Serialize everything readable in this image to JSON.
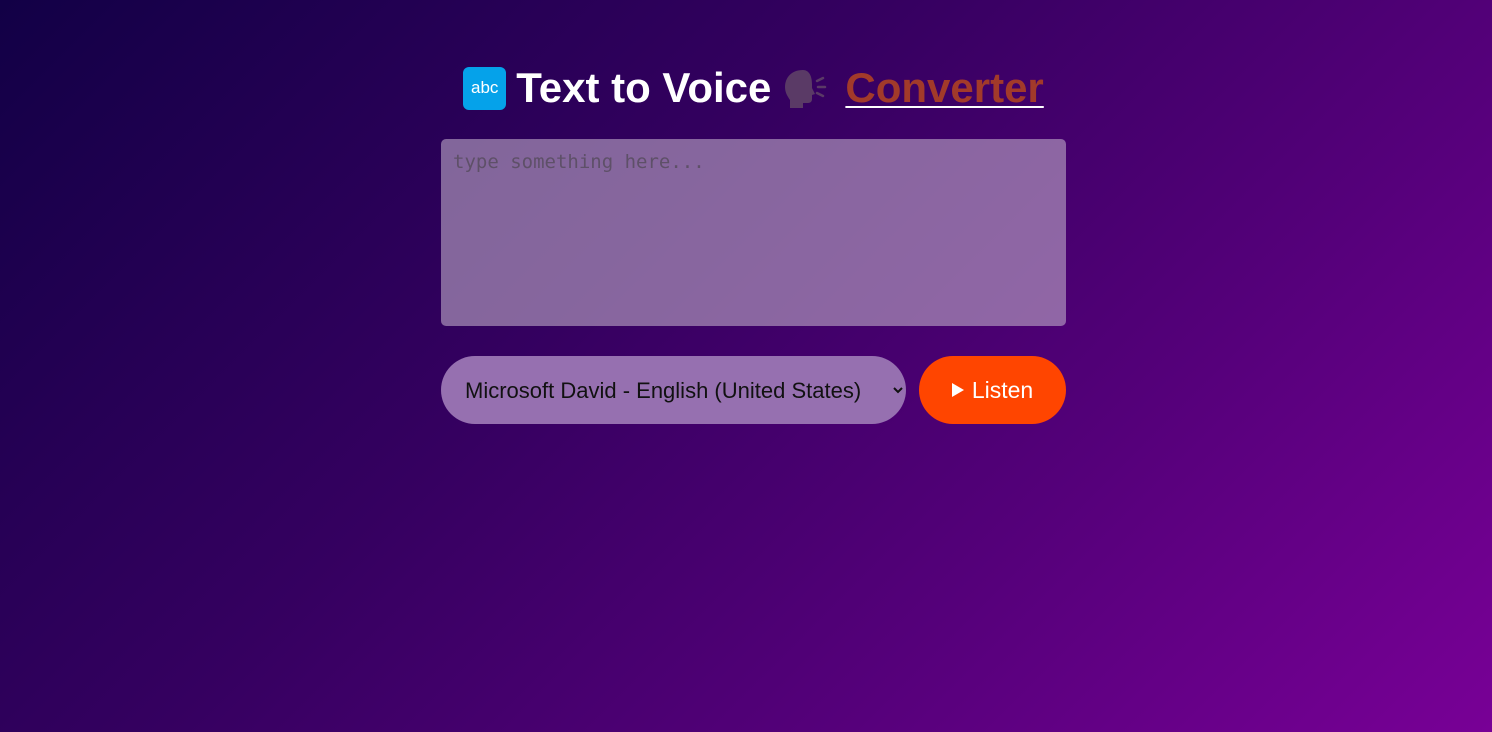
{
  "header": {
    "badge_icon": "abc-icon",
    "badge_text": "abc",
    "title_text": "Text to Voice",
    "speak_icon": "speaking-head-icon",
    "link_text": "Converter"
  },
  "editor": {
    "placeholder": "type something here...",
    "value": ""
  },
  "voice_select": {
    "selected": "Microsoft David - English (United States)"
  },
  "listen_button": {
    "icon": "play-icon",
    "label": "Listen"
  },
  "colors": {
    "accent": "#ff4500",
    "link": "#a23a2a",
    "badge": "#05a2ea",
    "background_start": "#120046",
    "background_end": "#780096"
  }
}
